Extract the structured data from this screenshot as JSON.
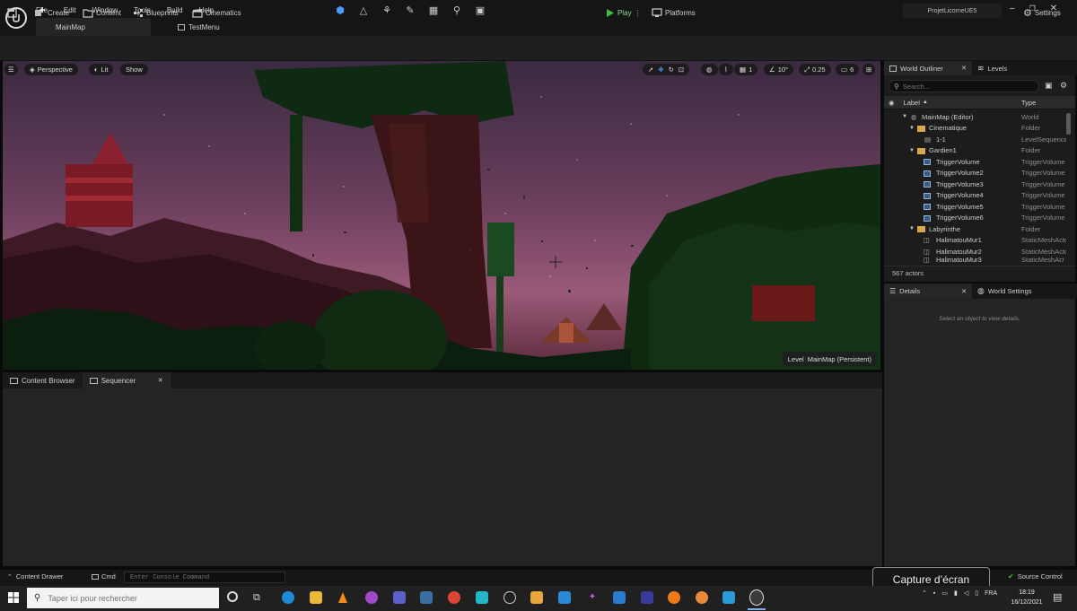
{
  "menu": [
    "File",
    "Edit",
    "Window",
    "Tools",
    "Build",
    "Help"
  ],
  "doc_tabs": [
    {
      "label": "MainMap"
    },
    {
      "label": "TestMenu"
    }
  ],
  "project_name": "ProjetLicorneUE5",
  "toolbar": {
    "create": "Create",
    "content": "Content",
    "blueprints": "Blueprints",
    "cinematics": "Cinematics",
    "play": "Play",
    "platforms": "Platforms",
    "settings": "Settings"
  },
  "viewport": {
    "perspective": "Perspective",
    "lit": "Lit",
    "show": "Show",
    "grid_snap": "1",
    "rotation_snap": "10°",
    "scale_snap": "0.25",
    "camera_speed": "6",
    "level_label": "Level",
    "level_name": "MainMap (Persistent)"
  },
  "bottom_tabs": [
    "Content Browser",
    "Sequencer"
  ],
  "outliner": {
    "tabs": [
      "World Outliner",
      "Levels"
    ],
    "search_placeholder": "Search...",
    "col_label": "Label",
    "col_type": "Type",
    "rows": [
      {
        "label": "MainMap (Editor)",
        "type": "World"
      },
      {
        "label": "Cinematique",
        "type": "Folder"
      },
      {
        "label": "1-1",
        "type": "LevelSequence"
      },
      {
        "label": "Gardien1",
        "type": "Folder"
      },
      {
        "label": "TriggerVolume",
        "type": "TriggerVolume"
      },
      {
        "label": "TriggerVolume2",
        "type": "TriggerVolume"
      },
      {
        "label": "TriggerVolume3",
        "type": "TriggerVolume"
      },
      {
        "label": "TriggerVolume4",
        "type": "TriggerVolume"
      },
      {
        "label": "TriggerVolume5",
        "type": "TriggerVolume"
      },
      {
        "label": "TriggerVolume6",
        "type": "TriggerVolume"
      },
      {
        "label": "Labyrinthe",
        "type": "Folder"
      },
      {
        "label": "HalimatouMur1",
        "type": "StaticMeshActor"
      },
      {
        "label": "HalimatouMur2",
        "type": "StaticMeshActor"
      },
      {
        "label": "HalimatouMur3",
        "type": "StaticMeshActor"
      }
    ],
    "actor_count": "567 actors"
  },
  "details": {
    "tabs": [
      "Details",
      "World Settings"
    ],
    "empty_message": "Select an object to view details."
  },
  "statusbar": {
    "content_drawer": "Content Drawer",
    "cmd": "Cmd",
    "console_placeholder": "Enter Console Command",
    "source_control": "Source Control"
  },
  "tooltip": "Capture d’écran",
  "taskbar": {
    "search_placeholder": "Taper ici pour rechercher",
    "language": "FRA",
    "time": "18:19",
    "date": "16/12/2021"
  },
  "colors": {
    "accent_blue": "#1f6fd1",
    "play_green": "#3fbf3f",
    "sky_pink": "#8a4a6e",
    "folder_yellow": "#d8a84a"
  }
}
